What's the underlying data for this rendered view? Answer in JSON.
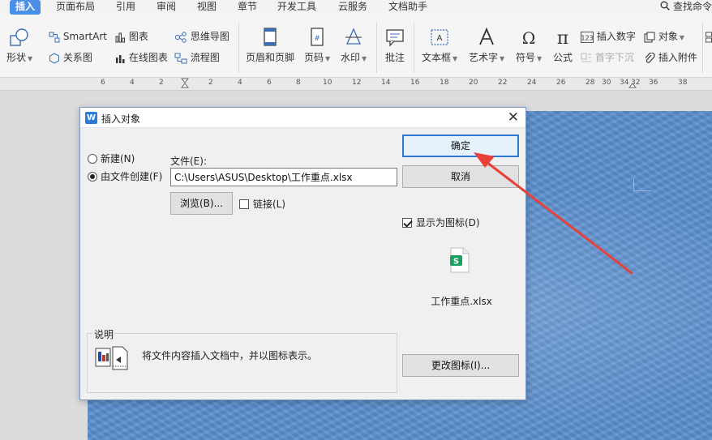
{
  "menu": {
    "tabs": [
      "插入",
      "页面布局",
      "引用",
      "审阅",
      "视图",
      "章节",
      "开发工具",
      "云服务",
      "文档助手"
    ],
    "active_tab": "插入",
    "find_label": "查找命令"
  },
  "ribbon": {
    "shape": "形状",
    "smartart": "SmartArt",
    "chart": "图表",
    "mindmap": "思维导图",
    "relation": "关系图",
    "online_chart": "在线图表",
    "flowchart": "流程图",
    "header_footer": "页眉和页脚",
    "page_number": "页码",
    "watermark": "水印",
    "comment": "批注",
    "textbox": "文本框",
    "wordart": "艺术字",
    "symbol": "符号",
    "formula": "公式",
    "dropcap": "首字下沉",
    "insert_number": "插入数字",
    "object": "对象",
    "insert_attachment": "插入附件"
  },
  "ruler": {
    "numbers": [
      "6",
      "4",
      "2",
      "2",
      "4",
      "6",
      "8",
      "10",
      "12",
      "14",
      "16",
      "18",
      "20",
      "22",
      "24",
      "26",
      "28",
      "30",
      "32",
      "34",
      "36",
      "38"
    ]
  },
  "dialog": {
    "title": "插入对象",
    "close_glyph": "✕",
    "logo_glyph": "W",
    "option_new": "新建(N)",
    "option_from_file": "由文件创建(F)",
    "selected_option": "from_file",
    "file_label": "文件(E):",
    "file_path": "C:\\Users\\ASUS\\Desktop\\工作重点.xlsx",
    "browse_button": "浏览(B)...",
    "link_label": "链接(L)",
    "link_checked": false,
    "ok_button": "确定",
    "cancel_button": "取消",
    "display_as_icon_label": "显示为图标(D)",
    "display_as_icon_checked": true,
    "icon_filename": "工作重点.xlsx",
    "icon_letter": "S",
    "group_label": "说明",
    "description": "将文件内容插入文档中，并以图标表示。",
    "change_icon_button": "更改图标(I)..."
  },
  "colors": {
    "accent": "#2d7bd9",
    "active_tab": "#4a8ee8",
    "annotation_arrow": "#e8413a",
    "page_background": "#5a8fcf",
    "xls_green": "#1aa260"
  }
}
